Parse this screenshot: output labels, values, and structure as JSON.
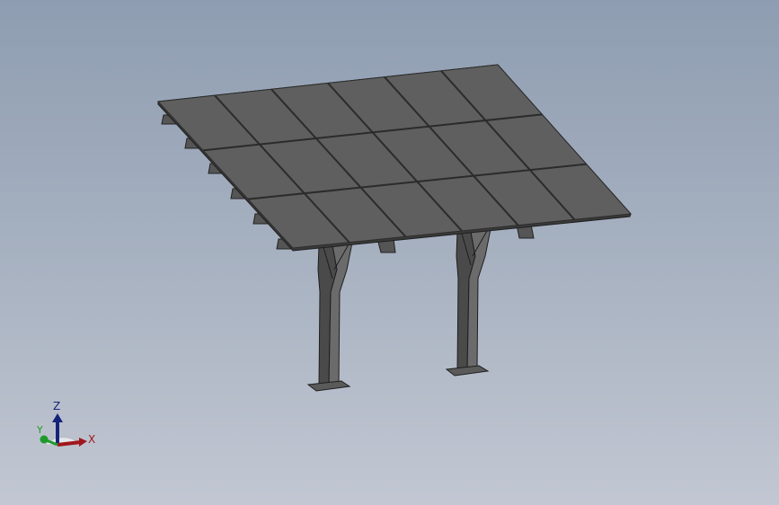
{
  "viewport": {
    "scene": "3d-model-view",
    "background_top": "#8e9db1",
    "background_bottom": "#c2c7d2"
  },
  "model": {
    "panel_rows": 3,
    "panel_cols": 6,
    "panel_color": "#5f5f5f",
    "frame_color": "#2b2b2b",
    "post_count": 2
  },
  "triad": {
    "x_label": "X",
    "y_label": "Y",
    "z_label": "Z",
    "x_color": "#a0161d",
    "y_color": "#1f9a2a",
    "z_color": "#15237a"
  }
}
